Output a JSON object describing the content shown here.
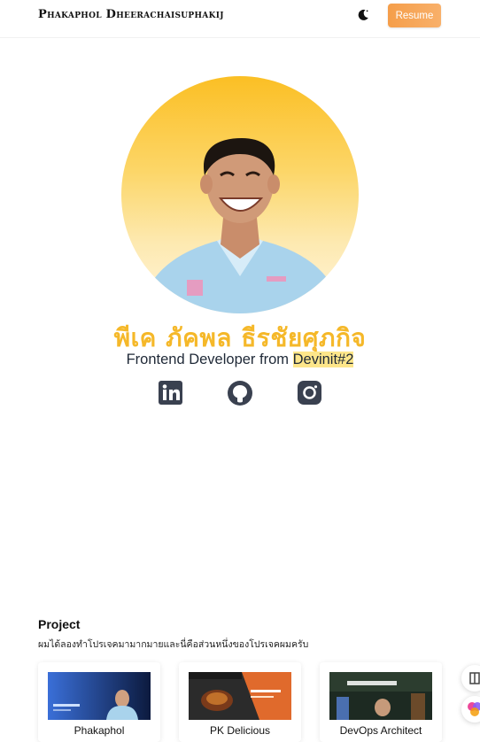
{
  "navbar": {
    "brand": "Phakaphol Dheerachaisuphakij",
    "theme_icon": "moon-icon",
    "resume_label": "Resume"
  },
  "hero": {
    "avatar_desc_icon": "profile-photo",
    "name": "พีเค ภัคพล ธีรชัยศุภกิจ",
    "subtitle_prefix": "Frontend Developer from ",
    "subtitle_highlight": "Devinit#2",
    "socials": [
      {
        "icon": "linkedin-icon"
      },
      {
        "icon": "github-icon"
      },
      {
        "icon": "instagram-icon"
      }
    ]
  },
  "projects": {
    "title": "Project",
    "description": "ผมได้ลองทำโปรเจคมามากมายและนี่คือส่วนหนึ่งของโปรเจคผมครับ",
    "cards": [
      {
        "title": "Phakaphol"
      },
      {
        "title": "PK Delicious"
      },
      {
        "title": "DevOps Architect"
      }
    ]
  },
  "colors": {
    "accent": "#f5b829",
    "resume_button": "#f59e4a",
    "highlight": "#fde68a"
  }
}
